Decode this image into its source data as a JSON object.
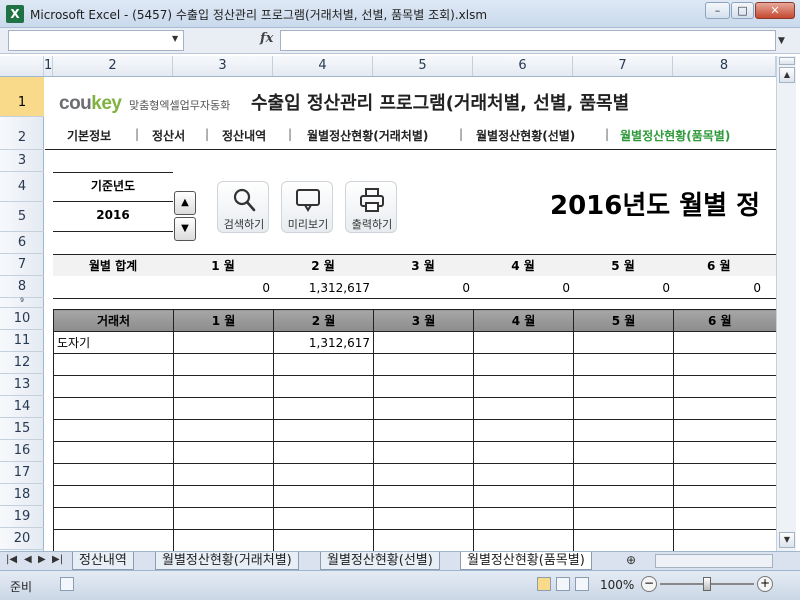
{
  "window": {
    "app_icon": "X",
    "title": "Microsoft Excel - (5457) 수출입 정산관리 프로그램(거래처별, 선별, 품목별 조회).xlsm",
    "min": "–",
    "max": "□",
    "close": "✕"
  },
  "formula_bar": {
    "name_box": "",
    "fx": "fx",
    "formula": ""
  },
  "columns": [
    "1",
    "2",
    "3",
    "4",
    "5",
    "6",
    "7",
    "8"
  ],
  "rows": [
    "1",
    "2",
    "3",
    "4",
    "5",
    "6",
    "7",
    "8",
    "9",
    "10",
    "11",
    "12",
    "13",
    "14",
    "15",
    "16",
    "17",
    "18",
    "19",
    "20"
  ],
  "logo": {
    "brand_main": "cou",
    "brand_accent": "key",
    "subtitle": "맞춤형엑셀업무자동화"
  },
  "program_title": "수출입 정산관리 프로그램(거래처별, 선별, 품목별",
  "nav": [
    {
      "label": "기본정보"
    },
    {
      "label": "정산서"
    },
    {
      "label": "정산내역"
    },
    {
      "label": "월별정산현황(거래처별)"
    },
    {
      "label": "월별정산현황(선별)"
    },
    {
      "label": "월별정산현황(품목별)"
    }
  ],
  "nav_sep": "|",
  "year": {
    "label": "기준년도",
    "value": "2016",
    "up": "▲",
    "down": "▼"
  },
  "tools": [
    {
      "icon": "search-icon",
      "label": "검색하기"
    },
    {
      "icon": "preview-icon",
      "label": "미리보기"
    },
    {
      "icon": "printer-icon",
      "label": "출력하기"
    }
  ],
  "report_title": "2016년도 월별 정",
  "summary": {
    "headers": [
      "월별 합계",
      "1 월",
      "2 월",
      "3 월",
      "4 월",
      "5 월",
      "6 월"
    ],
    "values": [
      "",
      "0",
      "1,312,617",
      "0",
      "0",
      "0",
      "0"
    ]
  },
  "table": {
    "headers": [
      "거래처",
      "1 월",
      "2 월",
      "3 월",
      "4 월",
      "5 월",
      "6 월"
    ],
    "rows": [
      [
        "도자기",
        "",
        "1,312,617",
        "",
        "",
        "",
        ""
      ],
      [
        "",
        "",
        "",
        "",
        "",
        "",
        ""
      ],
      [
        "",
        "",
        "",
        "",
        "",
        "",
        ""
      ],
      [
        "",
        "",
        "",
        "",
        "",
        "",
        ""
      ],
      [
        "",
        "",
        "",
        "",
        "",
        "",
        ""
      ],
      [
        "",
        "",
        "",
        "",
        "",
        "",
        ""
      ],
      [
        "",
        "",
        "",
        "",
        "",
        "",
        ""
      ],
      [
        "",
        "",
        "",
        "",
        "",
        "",
        ""
      ],
      [
        "",
        "",
        "",
        "",
        "",
        "",
        ""
      ],
      [
        "",
        "",
        "",
        "",
        "",
        "",
        ""
      ]
    ]
  },
  "sheet_tabs": [
    "정산내역",
    "월별정산현황(거래처별)",
    "월별정산현황(선별)",
    "월별정산현황(품목별)"
  ],
  "active_tab": "월별정산현황(품목별)",
  "status": {
    "ready": "준비",
    "zoom": "100%",
    "zoom_minus": "−",
    "zoom_plus": "+"
  }
}
